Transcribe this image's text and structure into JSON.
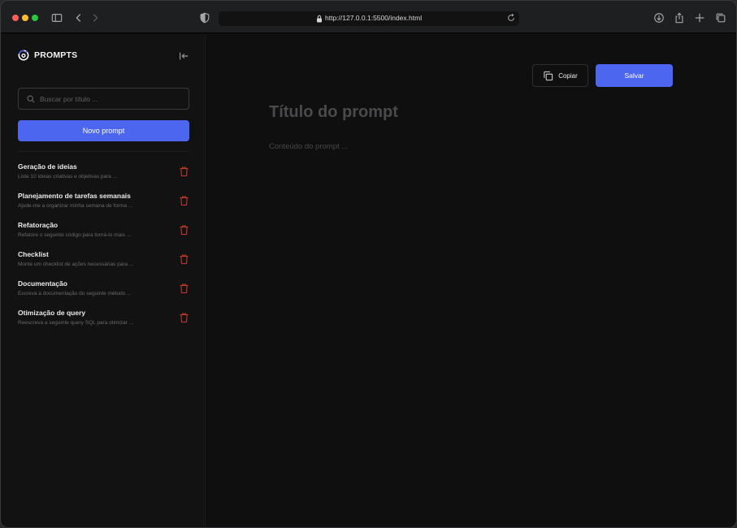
{
  "browser": {
    "url": "http://127.0.0.1:5500/index.html"
  },
  "sidebar": {
    "brand": "PROMPTS",
    "search_placeholder": "Buscar por título ...",
    "new_button_label": "Novo prompt",
    "items": [
      {
        "title": "Geração de ideias",
        "desc": "Liste 10 ideias criativas e objetivas para ..."
      },
      {
        "title": "Planejamento de tarefas semanais",
        "desc": "Ajude-me a organizar minha semana de forma ..."
      },
      {
        "title": "Refatoração",
        "desc": "Refatore o seguinte código para torná-lo mais ..."
      },
      {
        "title": "Checklist",
        "desc": "Monte um checklist de ações necessárias para ..."
      },
      {
        "title": "Documentação",
        "desc": "Escreva a documentação do seguinte método ..."
      },
      {
        "title": "Otimização de query",
        "desc": "Reescreva a seguinte query SQL para otimizar ..."
      }
    ]
  },
  "main": {
    "copy_label": "Copiar",
    "save_label": "Salvar",
    "title_placeholder": "Título do prompt",
    "content_placeholder": "Conteúdo do prompt ..."
  },
  "colors": {
    "accent": "#4d66f0",
    "danger": "#c0382f",
    "background": "#0f0f10",
    "sidebar": "#121213"
  }
}
